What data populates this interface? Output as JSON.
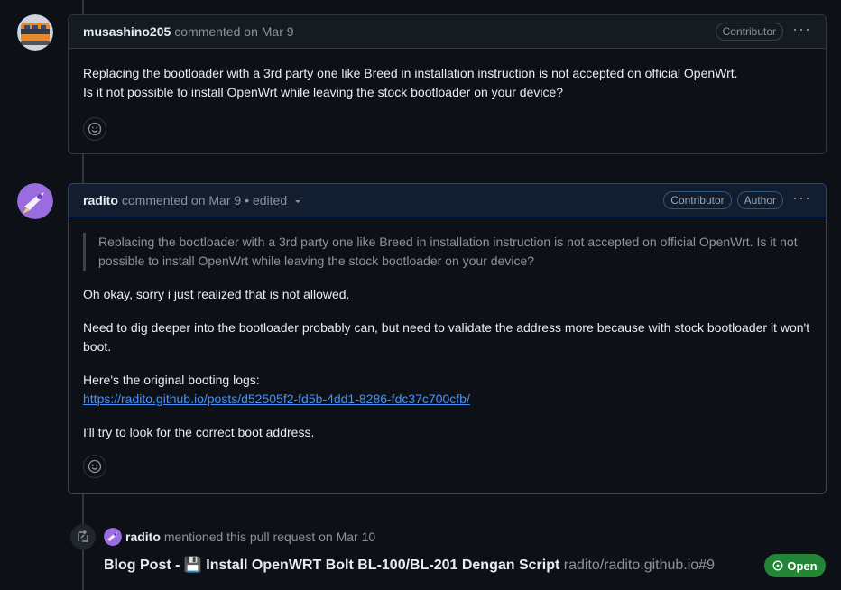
{
  "comments": [
    {
      "username": "musashino205",
      "meta": "commented on Mar 9",
      "badges": [
        "Contributor"
      ],
      "lines": [
        "Replacing the bootloader with a 3rd party one like Breed in installation instruction is not accepted on official OpenWrt.",
        "Is it not possible to install OpenWrt while leaving the stock bootloader on your device?"
      ]
    },
    {
      "username": "radito",
      "meta": "commented on Mar 9",
      "edited": "• edited",
      "badges": [
        "Contributor",
        "Author"
      ],
      "quote": "Replacing the bootloader with a 3rd party one like Breed in installation instruction is not accepted on official OpenWrt. Is it not possible to install OpenWrt while leaving the stock bootloader on your device?",
      "para1": "Oh okay, sorry i just realized that is not allowed.",
      "para2": "Need to dig deeper into the bootloader probably can, but need to validate the address more because with stock bootloader it won't boot.",
      "para3_text": "Here's the original booting logs:",
      "para3_link": "https://radito.github.io/posts/d52505f2-fd5b-4dd1-8286-fdc37c700cfb/",
      "para4": "I'll try to look for the correct boot address."
    }
  ],
  "event": {
    "username": "radito",
    "action": "mentioned this pull request on Mar 10",
    "title": "Blog Post - 💾 Install OpenWRT Bolt BL-100/BL-201 Dengan Script",
    "repo": "radito/radito.github.io#9",
    "status": "Open",
    "status_color": "#238636"
  },
  "icons": {
    "reaction": "smiley-icon",
    "menu": "kebab-icon",
    "cross_reference": "cross-reference-icon",
    "status": "pr-open-icon"
  },
  "colors": {
    "link": "#4493f8",
    "background": "#0d1117"
  }
}
